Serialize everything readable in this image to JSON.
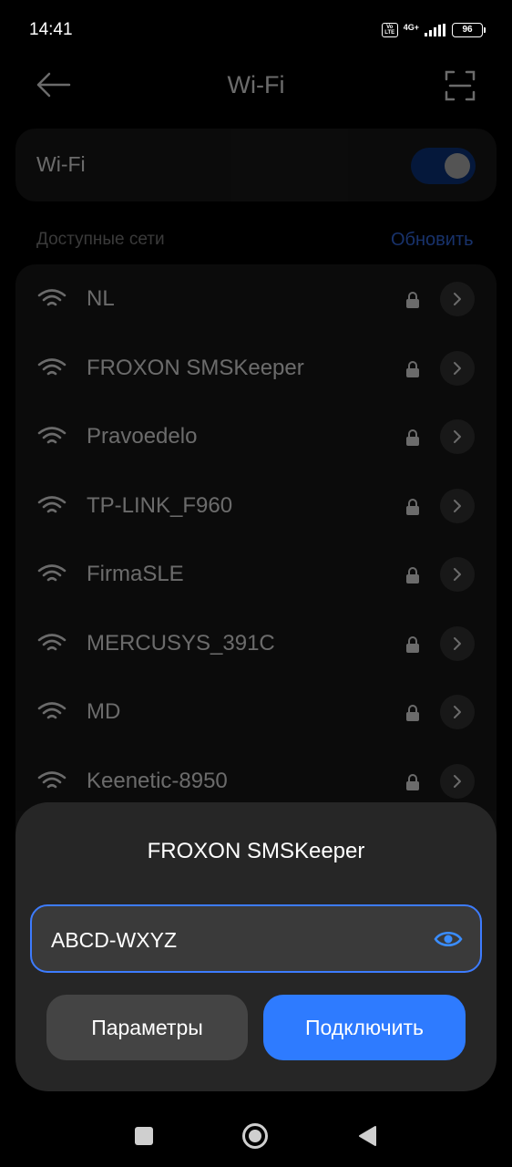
{
  "status_bar": {
    "time": "14:41",
    "network": "4G+",
    "volte": "Vo LTE",
    "battery": "96"
  },
  "header": {
    "title": "Wi-Fi"
  },
  "wifi_toggle": {
    "label": "Wi-Fi",
    "state": "on"
  },
  "networks_section": {
    "label": "Доступные сети",
    "refresh_label": "Обновить"
  },
  "networks": [
    {
      "name": "NL"
    },
    {
      "name": "FROXON SMSKeeper"
    },
    {
      "name": "Pravoedelo"
    },
    {
      "name": "TP-LINK_F960"
    },
    {
      "name": "FirmaSLE"
    },
    {
      "name": "MERCUSYS_391C"
    },
    {
      "name": "MD"
    },
    {
      "name": "Keenetic-8950"
    }
  ],
  "dialog": {
    "title": "FROXON SMSKeeper",
    "password_value": "ABCD-WXYZ",
    "params_label": "Параметры",
    "connect_label": "Подключить"
  },
  "colors": {
    "accent": "#2e7bff",
    "toggle_on": "#0d3b8e",
    "background": "#000000"
  }
}
